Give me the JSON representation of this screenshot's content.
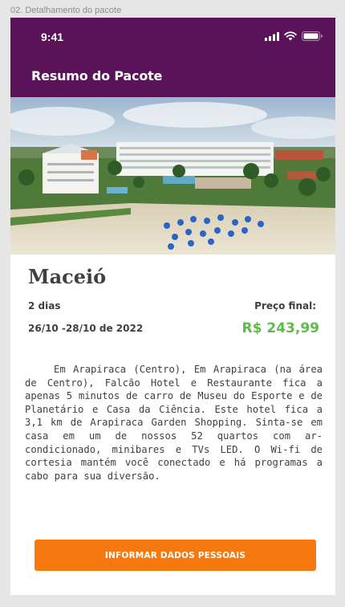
{
  "frame_label": "02. Detalhamento do pacote",
  "status_bar": {
    "time": "9:41",
    "icons": [
      "signal-icon",
      "wifi-icon",
      "battery-icon"
    ]
  },
  "header": {
    "title": "Resumo do Pacote"
  },
  "package": {
    "destination": "Maceió",
    "duration": "2 dias",
    "dates": "26/10 -28/10 de 2022",
    "price_label": "Preço final:",
    "price": "R$ 243,99",
    "description": "Em Arapiraca (Centro), Em Arapiraca (na área de Centro), Falcão Hotel e Restaurante fica a apenas 5 minutos de carro de Museu do Esporte e de Planetário e Casa da Ciência. Este hotel fica a 3,1 km de Arapiraca Garden Shopping. Sinta-se em casa em um de nossos 52 quartos com ar-condicionado, minibares e TVs LED. O Wi-fi de cortesia mantém você conectado e há programas a cabo para sua diversão."
  },
  "actions": {
    "primary_label": "INFORMAR DADOS PESSOAIS"
  },
  "colors": {
    "header_bg": "#5a1258",
    "price": "#5fb94b",
    "cta_bg": "#f7780f",
    "canvas_bg": "#e6e6e6"
  }
}
